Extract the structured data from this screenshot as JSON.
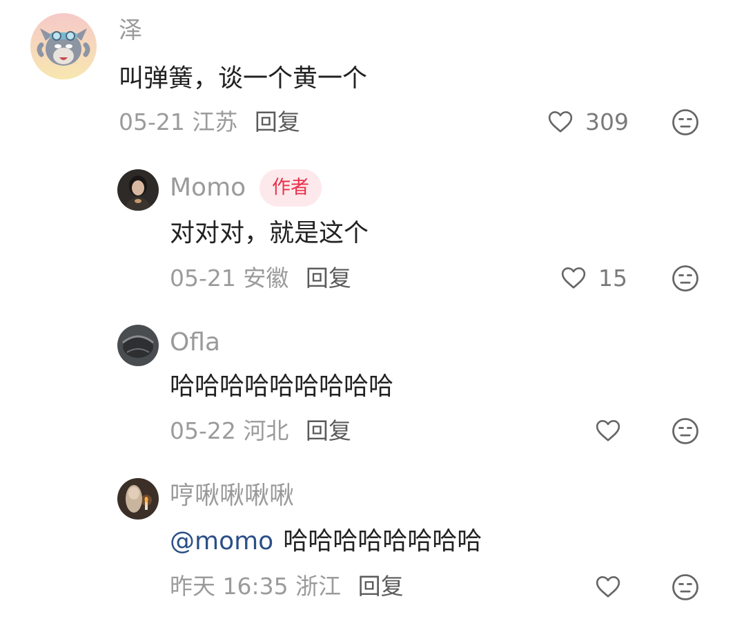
{
  "comments": [
    {
      "user": "泽",
      "text": "叫弹簧，谈一个黄一个",
      "date": "05-21",
      "location": "江苏",
      "reply_label": "回复",
      "likes": "309"
    },
    {
      "user": "Momo",
      "badge": "作者",
      "text": "对对对，就是这个",
      "date": "05-21",
      "location": "安徽",
      "reply_label": "回复",
      "likes": "15"
    },
    {
      "user": "Ofla",
      "text": "哈哈哈哈哈哈哈哈哈",
      "date": "05-22",
      "location": "河北",
      "reply_label": "回复",
      "likes": ""
    },
    {
      "user": "哼啾啾啾啾",
      "mention": "@momo",
      "text": "哈哈哈哈哈哈哈哈",
      "date": "昨天 16:35",
      "location": "浙江",
      "reply_label": "回复",
      "likes": ""
    }
  ],
  "colors": {
    "accent": "#e8304a",
    "mention": "#2b4f86",
    "muted": "#9b9b9b",
    "text": "#222222"
  },
  "icons": [
    "heart-outline-icon",
    "dislike-face-icon"
  ]
}
